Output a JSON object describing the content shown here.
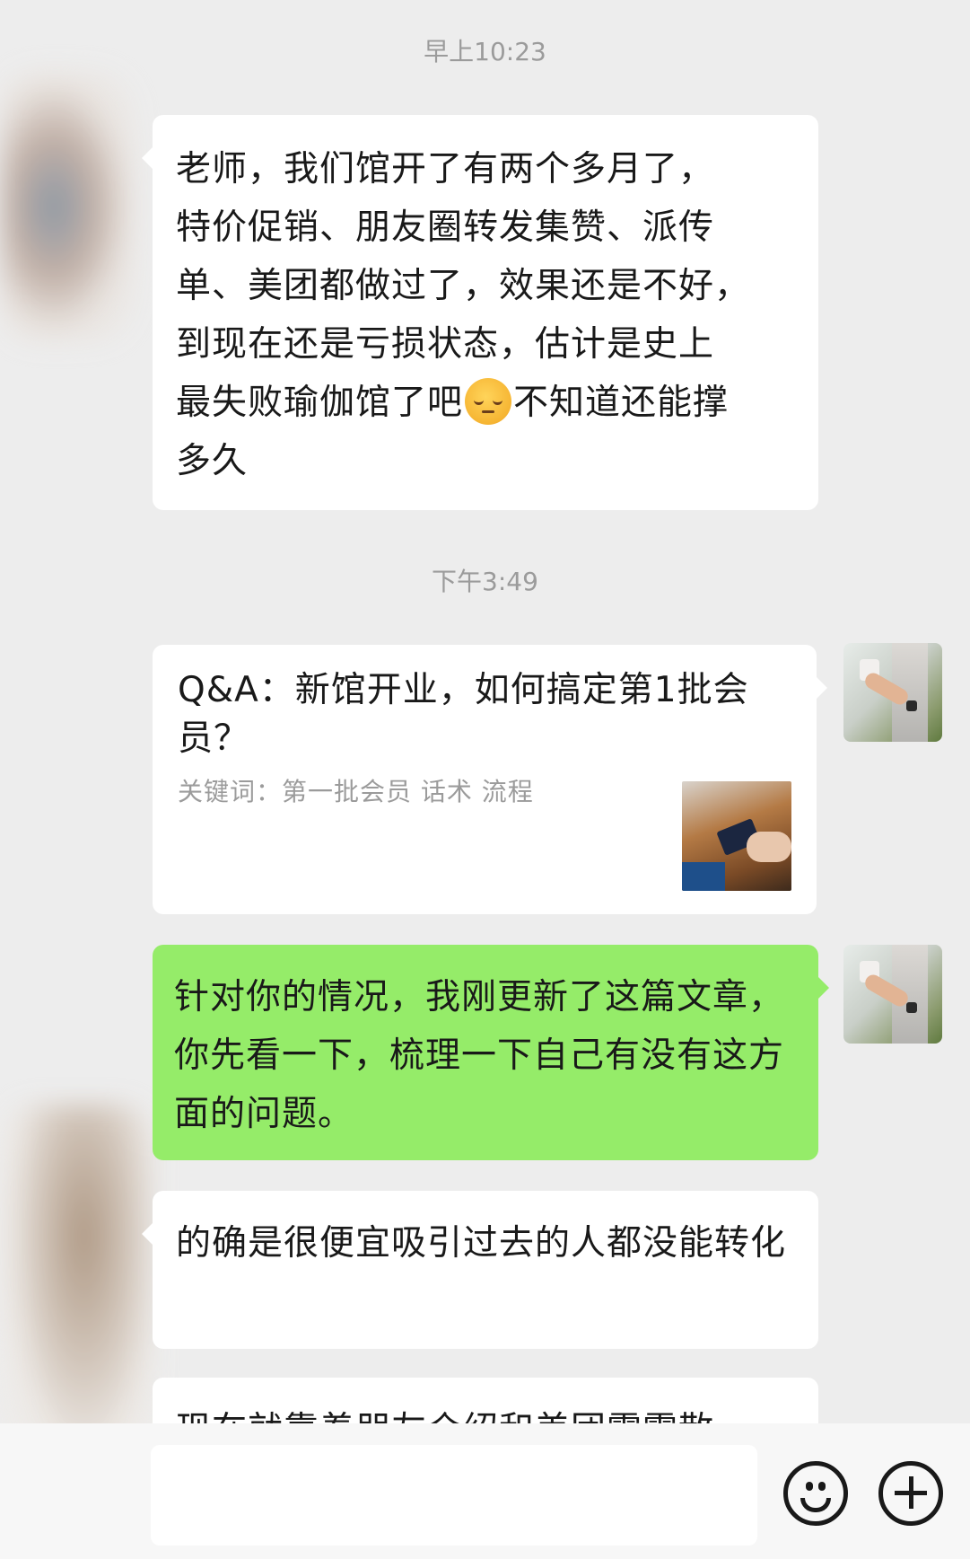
{
  "timestamps": {
    "first": "早上10:23",
    "second": "下午3:49"
  },
  "messages": {
    "m1_lines": [
      "老师，我们馆开了有两个多月了，",
      "特价促销、朋友圈转发集赞、派传",
      "单、美团都做过了，效果还是不好，",
      "到现在还是亏损状态，估计是史上"
    ],
    "m1_line5_before": "最失败瑜伽馆了吧",
    "m1_emoji": "pensive-face-icon",
    "m1_line5_after": "不知道还能撑",
    "m1_line6": "多久",
    "card": {
      "title": "Q&A：新馆开业，如何搞定第1批会员？",
      "keywords": "关键词：第一批会员 话术 流程"
    },
    "m3": "针对你的情况，我刚更新了这篇文章，你先看一下，梳理一下自己有没有这方面的问题。",
    "m4": "的确是很便宜吸引过去的人都没能转化",
    "m5_partial": "现在就靠着朋友介绍和美团零零散"
  },
  "input_bar": {
    "emoji_button_icon": "emoji-icon",
    "more_button_icon": "plus-circle-icon"
  },
  "colors": {
    "background": "#ededed",
    "incoming_bubble": "#ffffff",
    "outgoing_bubble": "#95ec69",
    "timestamp": "#9b9b9b"
  }
}
